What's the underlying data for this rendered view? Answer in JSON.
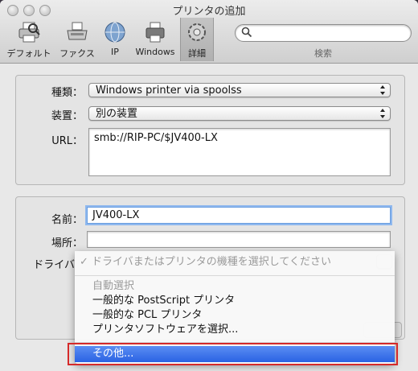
{
  "window": {
    "title": "プリンタの追加"
  },
  "toolbar": {
    "items": [
      {
        "label": "デフォルト",
        "icon": "printer-icon"
      },
      {
        "label": "ファクス",
        "icon": "fax-icon"
      },
      {
        "label": "IP",
        "icon": "globe-icon"
      },
      {
        "label": "Windows",
        "icon": "windows-printer-icon"
      },
      {
        "label": "詳細",
        "icon": "gear-icon",
        "selected": true
      }
    ],
    "search": {
      "placeholder": "",
      "label": "検索"
    }
  },
  "form": {
    "type": {
      "label": "種類：",
      "value": "Windows printer via spoolss"
    },
    "device": {
      "label": "装置：",
      "value": "別の装置"
    },
    "url": {
      "label": "URL：",
      "value": "smb://RIP-PC/$JV400-LX"
    },
    "name": {
      "label": "名前：",
      "value": "JV400-LX"
    },
    "location": {
      "label": "場所：",
      "value": ""
    },
    "driver": {
      "label": "ドライバ"
    }
  },
  "driver_menu": {
    "selected_item": "ドライバまたはプリンタの機種を選択してください",
    "section_header": "自動選択",
    "items": [
      "一般的な PostScript プリンタ",
      "一般的な PCL プリンタ",
      "プリンタソフトウェアを選択..."
    ],
    "highlighted_item": "その他...",
    "checkmark": "✓"
  },
  "colors": {
    "highlight": "#2a62e3",
    "annotation": "#d62a2a",
    "focus": "#8fb8ee"
  }
}
